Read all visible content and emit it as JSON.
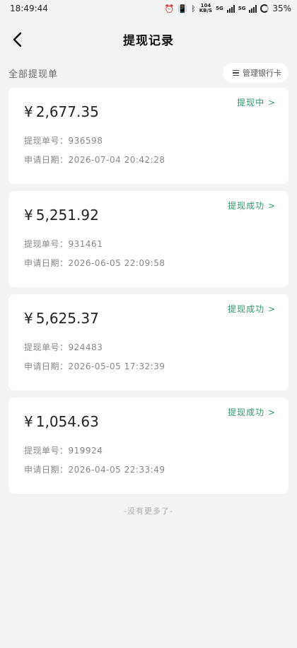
{
  "status_bar": {
    "time": "18:49:44",
    "icons": [
      "alarm-icon",
      "vibrate-icon",
      "bluetooth-icon"
    ],
    "net_speed_value": "104",
    "net_speed_unit": "KB/S",
    "sim1_label": "5G",
    "sim2_label": "5G",
    "battery": "35%"
  },
  "navbar": {
    "title": "提现记录",
    "back_icon": "chevron-left-icon"
  },
  "sub_header": {
    "filter_label": "全部提现单",
    "manage_label": "管理银行卡",
    "manage_icon": "menu-icon"
  },
  "colors": {
    "status_green": "#2e9a68",
    "background": "#f2f4f4",
    "card": "#ffffff"
  },
  "records": [
    {
      "status": "提现中 >",
      "currency": "¥",
      "amount": "2,677.35",
      "order_label": "提现单号：",
      "order_no": "936598",
      "date_label": "申请日期：",
      "date": "2026-07-04 20:42:28"
    },
    {
      "status": "提现成功 >",
      "currency": "¥",
      "amount": "5,251.92",
      "order_label": "提现单号：",
      "order_no": "931461",
      "date_label": "申请日期：",
      "date": "2026-06-05 22:09:58"
    },
    {
      "status": "提现成功 >",
      "currency": "¥",
      "amount": "5,625.37",
      "order_label": "提现单号：",
      "order_no": "924483",
      "date_label": "申请日期：",
      "date": "2026-05-05 17:32:39"
    },
    {
      "status": "提现成功 >",
      "currency": "¥",
      "amount": "1,054.63",
      "order_label": "提现单号：",
      "order_no": "919924",
      "date_label": "申请日期：",
      "date": "2026-04-05 22:33:49"
    }
  ],
  "footer": {
    "note": "-没有更多了-"
  }
}
